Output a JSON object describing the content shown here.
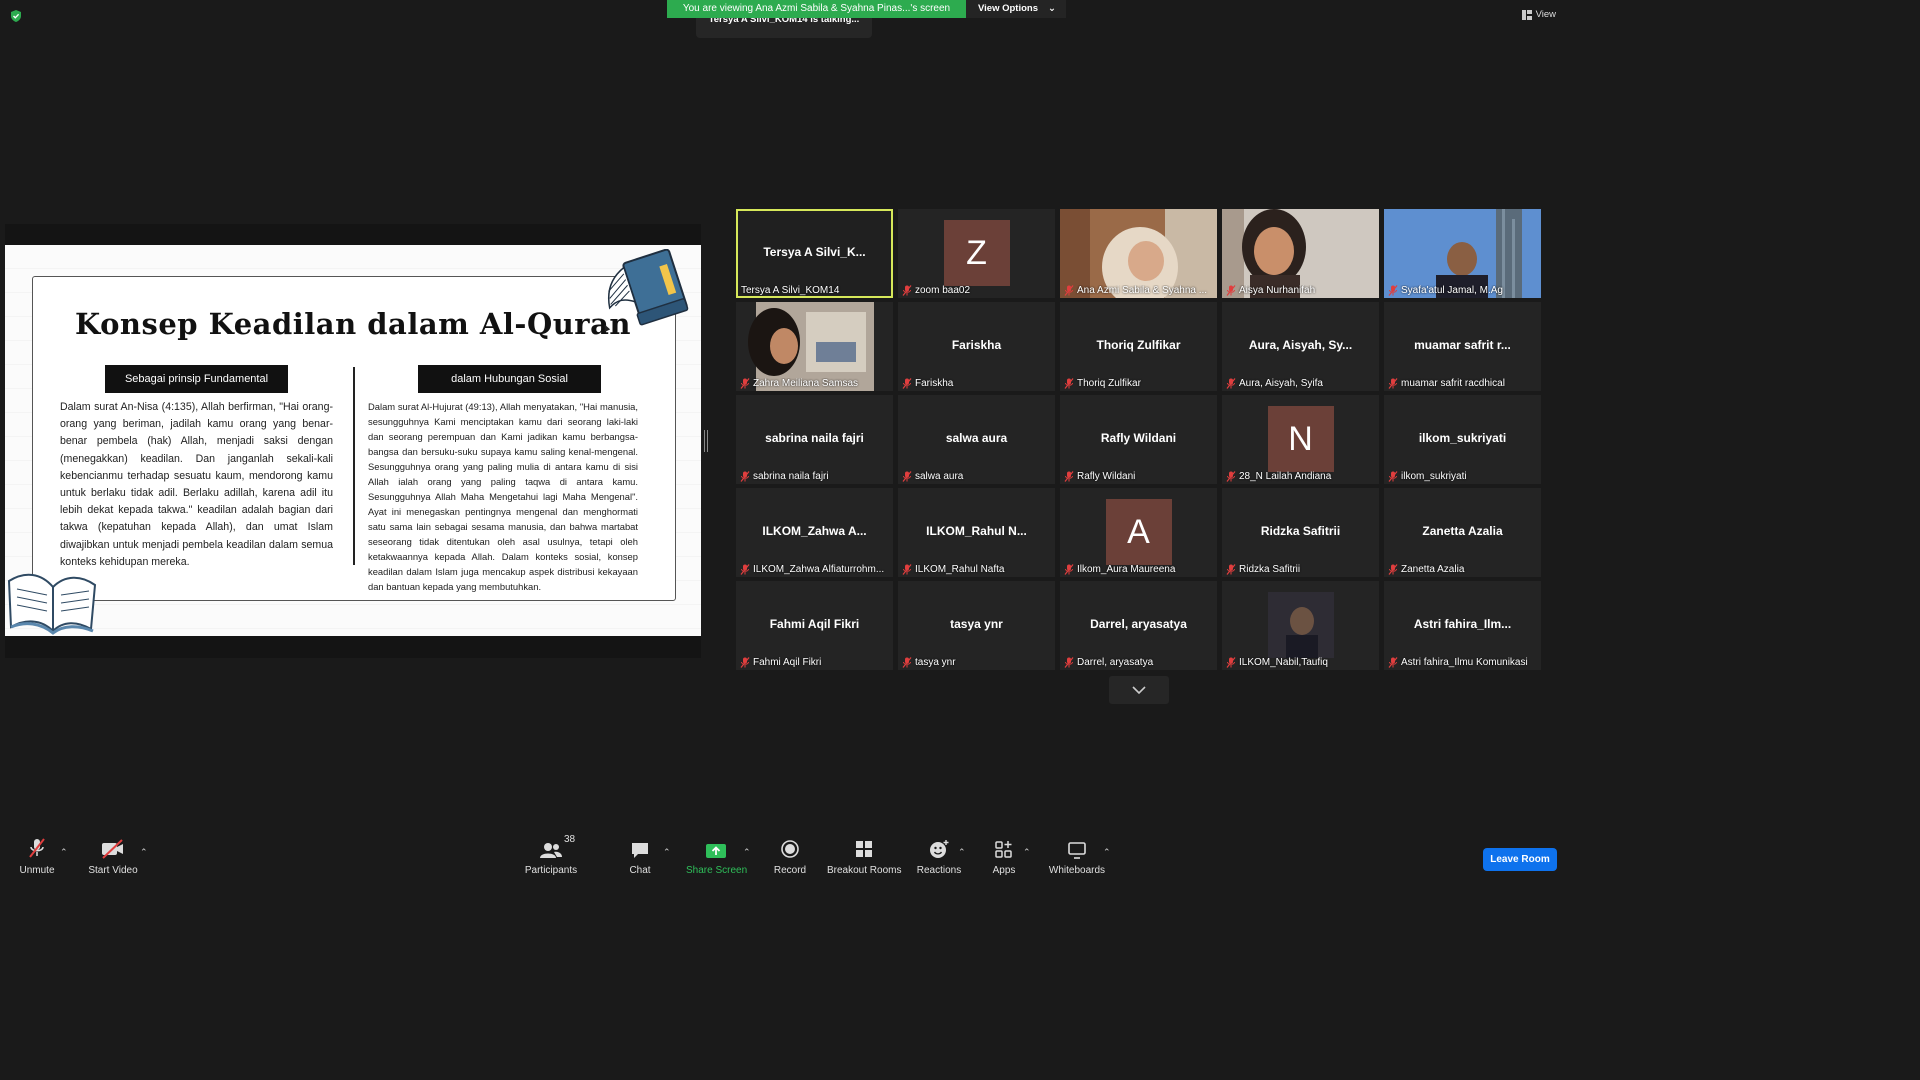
{
  "topbar": {
    "banner_message": "You are viewing Ana Azmi Sabila & Syahna Pinas...'s screen",
    "view_options_label": "View Options",
    "talking_indicator": "Tersya A Silvi_KOM14 is talking...",
    "view_label": "View"
  },
  "slide": {
    "title": "Konsep Keadilan dalam Al-Quran",
    "left_label": "Sebagai prinsip Fundamental",
    "right_label": "dalam Hubungan Sosial",
    "left_text": "Dalam surat An-Nisa (4:135), Allah berfirman, \"Hai orang-orang yang beriman, jadilah kamu orang yang benar-benar pembela (hak) Allah, menjadi saksi dengan (menegakkan) keadilan. Dan janganlah sekali-kali kebencianmu terhadap sesuatu kaum, mendorong kamu untuk berlaku tidak adil. Berlaku adillah, karena adil itu lebih dekat kepada takwa.\" keadilan adalah bagian dari takwa (kepatuhan kepada Allah), dan umat Islam diwajibkan untuk menjadi pembela keadilan dalam semua konteks kehidupan mereka.",
    "right_text": "Dalam surat Al-Hujurat (49:13), Allah menyatakan, \"Hai manusia, sesungguhnya Kami menciptakan kamu dari seorang laki-laki dan seorang perempuan dan Kami jadikan kamu berbangsa-bangsa dan bersuku-suku supaya kamu saling kenal-mengenal. Sesungguhnya orang yang paling mulia di antara kamu di sisi Allah ialah orang yang paling taqwa di antara kamu. Sesungguhnya Allah Maha Mengetahui lagi Maha Mengenal\". Ayat ini menegaskan pentingnya mengenal dan menghormati satu sama lain sebagai sesama manusia, dan bahwa martabat seseorang tidak ditentukan oleh asal usulnya, tetapi oleh ketakwaannya kepada Allah. Dalam konteks sosial, konsep keadilan dalam Islam juga mencakup aspek distribusi kekayaan dan bantuan kepada yang membutuhkan."
  },
  "participants": [
    {
      "name": "Tersya A Silvi_KOM14",
      "center": "Tersya A Silvi_K...",
      "type": "name",
      "active": true,
      "muted": false
    },
    {
      "name": "zoom baa02",
      "center": "Z",
      "type": "avatar",
      "muted": true
    },
    {
      "name": "Ana Azmi Sabila & Syahna ...",
      "center": "",
      "type": "photo-hijab",
      "muted": true
    },
    {
      "name": "Aisya Nurhanifah",
      "center": "",
      "type": "photo-girl",
      "muted": true
    },
    {
      "name": "Syafa'atul Jamal, M.Ag",
      "center": "",
      "type": "photo-sky",
      "muted": true
    },
    {
      "name": "Zahra Meiliana Samsas",
      "center": "",
      "type": "photo-mall",
      "muted": true
    },
    {
      "name": "Fariskha",
      "center": "Fariskha",
      "type": "name",
      "muted": true
    },
    {
      "name": "Thoriq Zulfikar",
      "center": "Thoriq Zulfikar",
      "type": "name",
      "muted": true
    },
    {
      "name": "Aura, Aisyah, Syifa",
      "center": "Aura, Aisyah, Sy...",
      "type": "name",
      "muted": true
    },
    {
      "name": "muamar safrit racdhical",
      "center": "muamar safrit r...",
      "type": "name",
      "muted": true
    },
    {
      "name": "sabrina naila fajri",
      "center": "sabrina naila fajri",
      "type": "name",
      "muted": true
    },
    {
      "name": "salwa aura",
      "center": "salwa aura",
      "type": "name",
      "muted": true
    },
    {
      "name": "Rafly Wildani",
      "center": "Rafly Wildani",
      "type": "name",
      "muted": true
    },
    {
      "name": "28_N Lailah Andiana",
      "center": "N",
      "type": "avatar",
      "muted": true
    },
    {
      "name": "ilkom_sukriyati",
      "center": "ilkom_sukriyati",
      "type": "name",
      "muted": true
    },
    {
      "name": "ILKOM_Zahwa Alfiaturrohm...",
      "center": "ILKOM_Zahwa A...",
      "type": "name",
      "muted": true
    },
    {
      "name": "ILKOM_Rahul Nafta",
      "center": "ILKOM_Rahul N...",
      "type": "name",
      "muted": true
    },
    {
      "name": "Ilkom_Aura Maureena",
      "center": "A",
      "type": "avatar",
      "muted": true
    },
    {
      "name": "Ridzka Safitrii",
      "center": "Ridzka Safitrii",
      "type": "name",
      "muted": true
    },
    {
      "name": "Zanetta Azalia",
      "center": "Zanetta Azalia",
      "type": "name",
      "muted": true
    },
    {
      "name": "Fahmi Aqil Fikri",
      "center": "Fahmi Aqil Fikri",
      "type": "name",
      "muted": true
    },
    {
      "name": "tasya ynr",
      "center": "tasya ynr",
      "type": "name",
      "muted": true
    },
    {
      "name": "Darrel, aryasatya",
      "center": "Darrel, aryasatya",
      "type": "name",
      "muted": true
    },
    {
      "name": "ILKOM_Nabil,Taufiq",
      "center": "",
      "type": "photo-dark",
      "muted": true
    },
    {
      "name": "Astri fahira_Ilmu Komunikasi",
      "center": "Astri fahira_Ilm...",
      "type": "name",
      "muted": true
    }
  ],
  "toolbar": {
    "unmute": "Unmute",
    "start_video": "Start Video",
    "participants": "Participants",
    "participants_count": "38",
    "chat": "Chat",
    "share_screen": "Share Screen",
    "record": "Record",
    "breakout_rooms": "Breakout Rooms",
    "reactions": "Reactions",
    "apps": "Apps",
    "whiteboards": "Whiteboards",
    "leave_room": "Leave Room"
  },
  "colors": {
    "background": "#1a1a1a",
    "banner_green": "#2dab4f",
    "active_speaker_border": "#d6e85a",
    "mute_red": "#e03e3e",
    "leave_blue": "#0e72ed"
  }
}
